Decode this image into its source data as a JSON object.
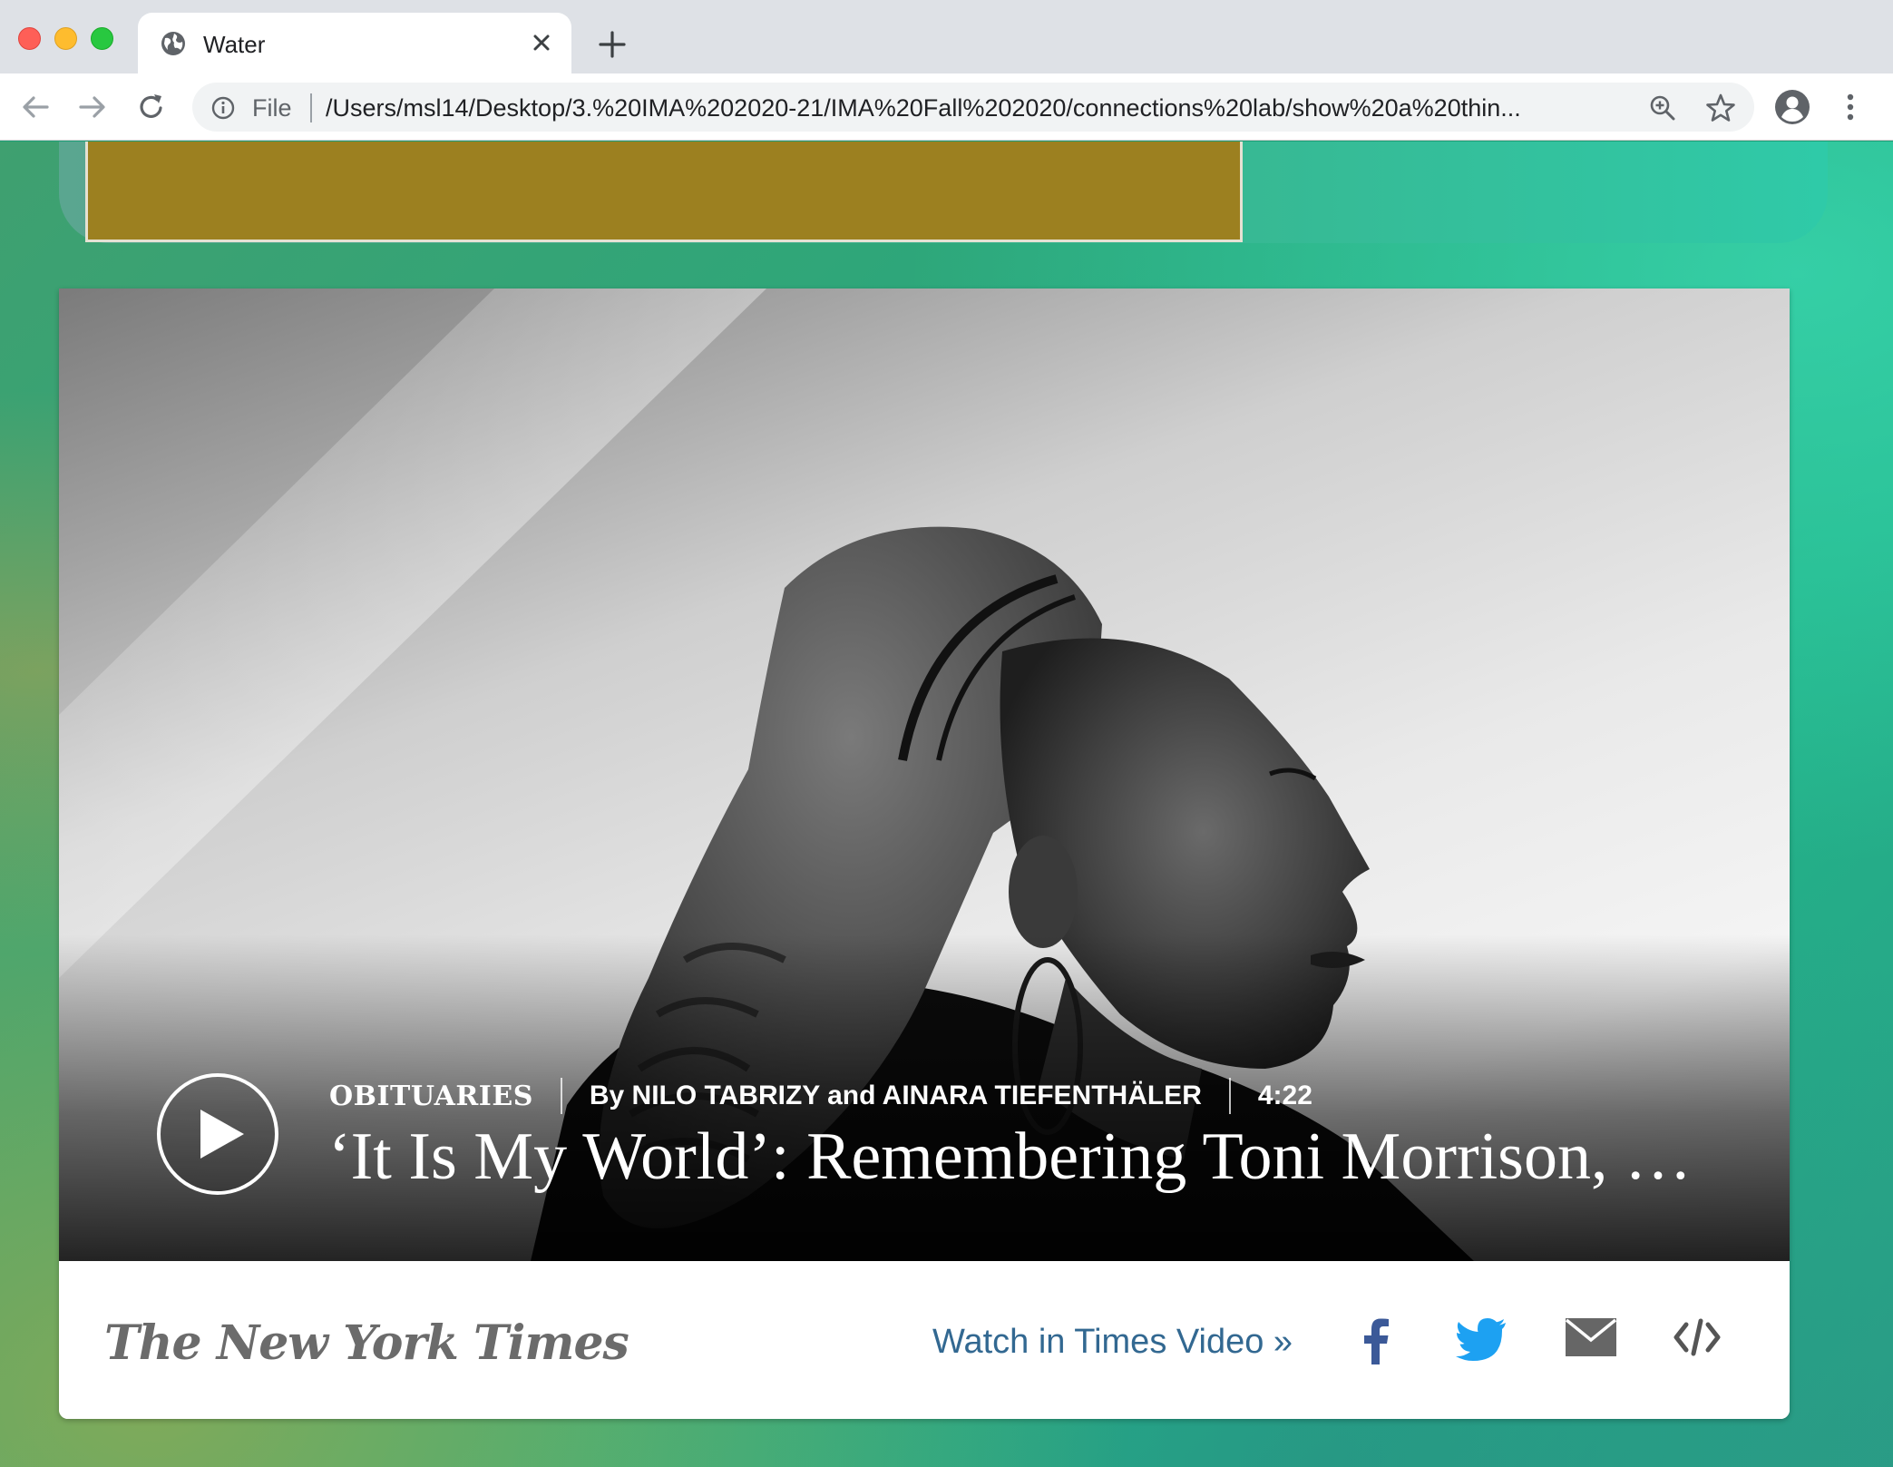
{
  "browser": {
    "tab": {
      "title": "Water"
    },
    "address_bar": {
      "scheme_label": "File",
      "url": "/Users/msl14/Desktop/3.%20IMA%202020-21/IMA%20Fall%202020/connections%20lab/show%20a%20thin..."
    }
  },
  "video": {
    "section": "OBITUARIES",
    "byline": "By NILO TABRIZY and AINARA TIEFENTHÄLER",
    "duration": "4:22",
    "headline": "‘It Is My World’: Remembering Toni Morrison, …",
    "play_icon": "play-icon"
  },
  "footer": {
    "logo_text": "The New York Times",
    "watch_link": "Watch in Times Video »",
    "share_icons": [
      "facebook-icon",
      "twitter-icon",
      "email-icon",
      "embed-icon"
    ]
  },
  "colors": {
    "olive_box": "#9c8020",
    "link_blue": "#326891",
    "facebook": "#3b5998",
    "twitter": "#1da1f2"
  }
}
